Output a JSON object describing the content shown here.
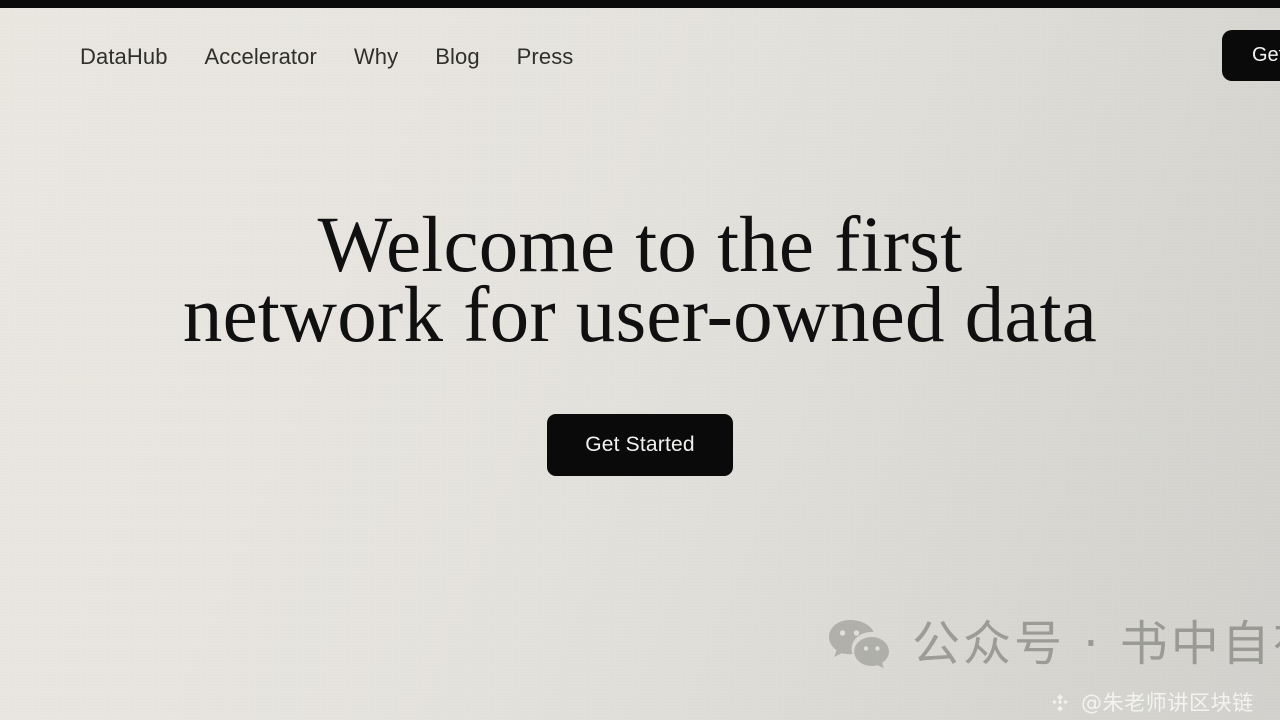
{
  "chrome": {
    "top_bar_color": "#0a0a0a"
  },
  "theme": {
    "background_left": "#eae7e1",
    "background_right": "#d2d1cd",
    "text_primary": "#101010",
    "nav_text": "#2f2f2d",
    "button_background": "#0a0a0a",
    "button_text": "#f2f1ef"
  },
  "header": {
    "nav": [
      {
        "label": "DataHub"
      },
      {
        "label": "Accelerator"
      },
      {
        "label": "Why"
      },
      {
        "label": "Blog"
      },
      {
        "label": "Press"
      }
    ],
    "cta": {
      "label": "Get Started",
      "visible_text": "Get"
    }
  },
  "hero": {
    "title_line1": "Welcome to the first",
    "title_line2": "network for user-owned data",
    "title_full": "Welcome to the first network for user-owned data",
    "cta_label": "Get Started"
  },
  "watermark": {
    "icon": "wechat-icon",
    "text": "公众号 · 书中自有",
    "handle_icon": "bnb-diamond-icon",
    "handle_text": "@朱老师讲区块链",
    "text_color": "#787873",
    "handle_color": "#f3f3f1"
  }
}
